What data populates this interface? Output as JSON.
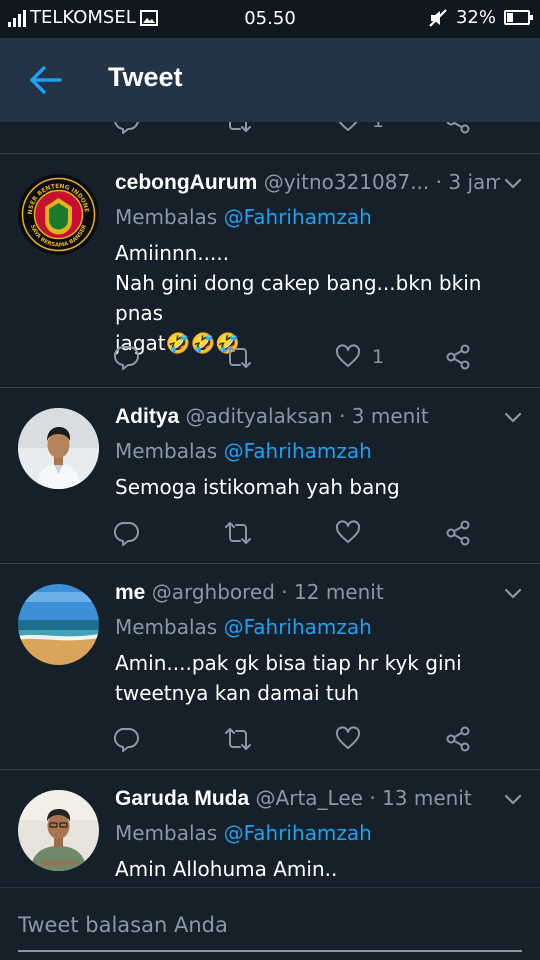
{
  "status_bar": {
    "carrier": "TELKOMSEL",
    "time": "05.50",
    "battery": "32%",
    "battery_level": 0.32
  },
  "header": {
    "title": "Tweet"
  },
  "colors": {
    "background": "#15202b",
    "header": "#243447",
    "accent": "#1da1f2",
    "muted": "#8899a6",
    "divider": "#38444d"
  },
  "partial_tweet": {
    "like_count": "1"
  },
  "tweets": [
    {
      "name": "cebongAurum",
      "handle": "@yitno321087...",
      "time": "· 3 jam",
      "reply_prefix": "Membalas",
      "reply_to": "@Fahrihamzah",
      "line1": "Amiinnn.....",
      "line2": "Nah gini dong cakep bang...bkn bkin pnas",
      "line3": "jagat🤣🤣🤣",
      "like_count": "1",
      "avatar_text_top": "BANSER BENTENG INDONESIA",
      "avatar_text_bottom": "SAYA BERSAMA BANSER"
    },
    {
      "name": "Aditya",
      "handle": "@adityalaksan",
      "time": "· 3 menit",
      "reply_prefix": "Membalas",
      "reply_to": "@Fahrihamzah",
      "line1": "Semoga istikomah yah bang",
      "like_count": ""
    },
    {
      "name": "me",
      "handle": "@arghbored",
      "time": "· 12 menit",
      "reply_prefix": "Membalas",
      "reply_to": "@Fahrihamzah",
      "line1": "Amin....pak gk bisa tiap hr kyk gini",
      "line2": "tweetnya kan damai tuh",
      "like_count": ""
    },
    {
      "name": "Garuda Muda",
      "handle": "@Arta_Lee",
      "time": "· 13 menit",
      "reply_prefix": "Membalas",
      "reply_to": "@Fahrihamzah",
      "line1": "Amin Allohuma Amin.."
    }
  ],
  "compose": {
    "placeholder": "Tweet balasan Anda"
  },
  "icons": [
    "signal-icon",
    "image-icon",
    "mute-icon",
    "battery-icon",
    "back-arrow-icon",
    "chevron-down-icon",
    "reply-icon",
    "retweet-icon",
    "like-icon",
    "share-icon"
  ]
}
